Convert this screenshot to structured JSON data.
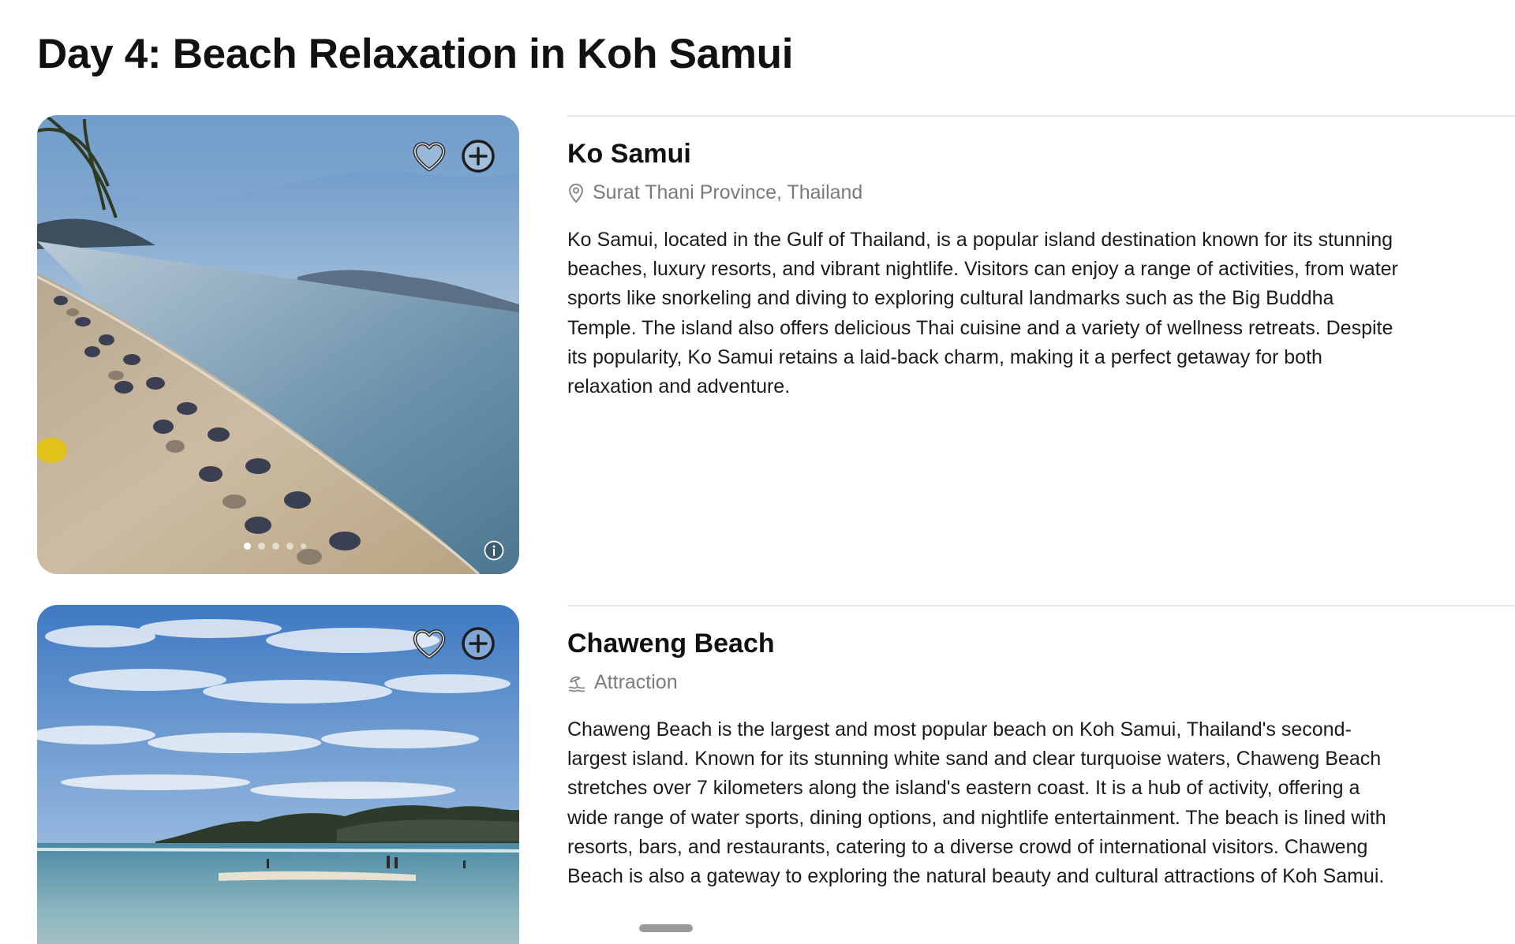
{
  "page": {
    "title": "Day 4: Beach Relaxation in Koh Samui"
  },
  "places": [
    {
      "name": "Ko Samui",
      "meta_icon": "location-pin-icon",
      "meta": "Surat Thani Province, Thailand",
      "description": "Ko Samui, located in the Gulf of Thailand, is a popular island destination known for its stunning beaches, luxury resorts, and vibrant nightlife. Visitors can enjoy a range of activities, from water sports like snorkeling and diving to exploring cultural landmarks such as the Big Buddha Temple. The island also offers delicious Thai cuisine and a variety of wellness retreats. Despite its popularity, Ko Samui retains a laid-back charm, making it a perfect getaway for both relaxation and adventure.",
      "photo": {
        "dot_count": 5,
        "active_dot": 1
      }
    },
    {
      "name": "Chaweng Beach",
      "meta_icon": "beach-umbrella-icon",
      "meta": "Attraction",
      "description": "Chaweng Beach is the largest and most popular beach on Koh Samui, Thailand's second-largest island. Known for its stunning white sand and clear turquoise waters, Chaweng Beach stretches over 7 kilometers along the island's eastern coast. It is a hub of activity, offering a wide range of water sports, dining options, and nightlife entertainment. The beach is lined with resorts, bars, and restaurants, catering to a diverse crowd of international visitors. Chaweng Beach is also a gateway to exploring the natural beauty and cultural attractions of Koh Samui."
    }
  ],
  "icons": {
    "favorite": "heart-outline-icon",
    "add": "plus-circle-icon",
    "info": "info-icon"
  },
  "colors": {
    "text": "#111111",
    "muted": "#7a7a7a",
    "divider": "#e6e6e6"
  }
}
